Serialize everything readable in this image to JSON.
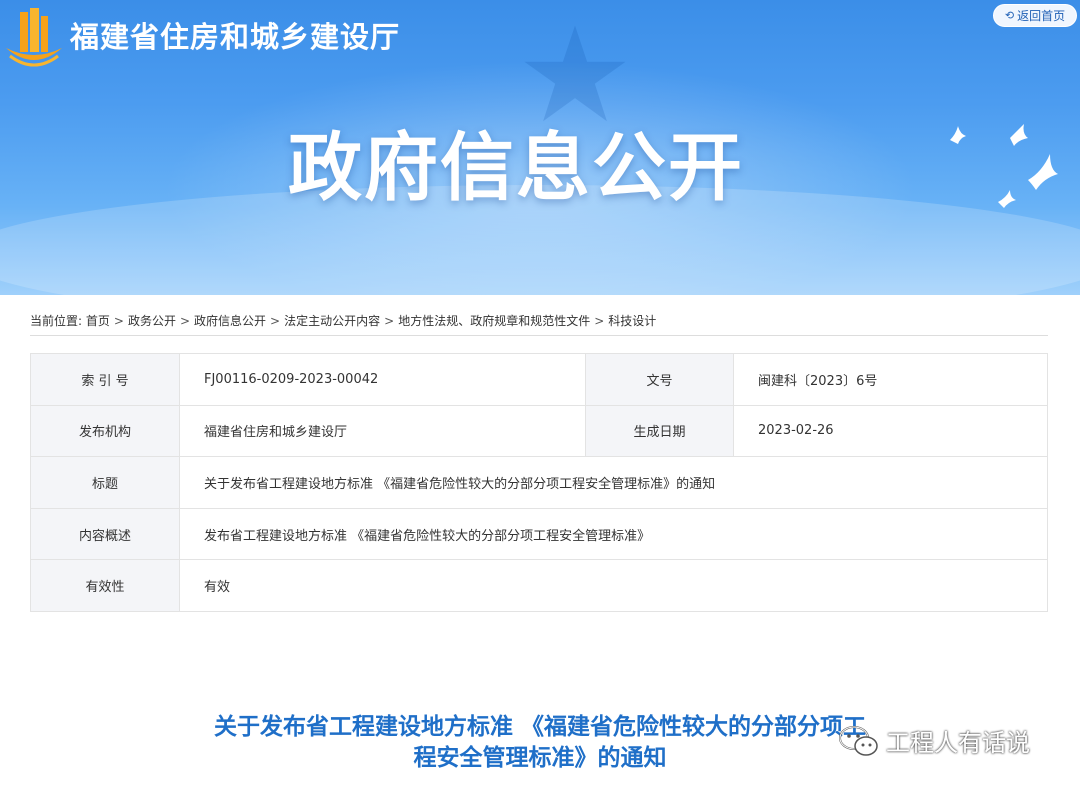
{
  "header": {
    "site_name": "福建省住房和城乡建设厅",
    "back_home": "返回首页",
    "banner_title": "政府信息公开"
  },
  "breadcrumb": {
    "prefix": "当前位置:",
    "items": [
      "首页",
      "政务公开",
      "政府信息公开",
      "法定主动公开内容",
      "地方性法规、政府规章和规范性文件",
      "科技设计"
    ],
    "separator": ">"
  },
  "meta": {
    "index_label": "索 引 号",
    "index_value": "FJ00116-0209-2023-00042",
    "docno_label": "文号",
    "docno_value": "闽建科〔2023〕6号",
    "publisher_label": "发布机构",
    "publisher_value": "福建省住房和城乡建设厅",
    "date_label": "生成日期",
    "date_value": "2023-02-26",
    "title_label": "标题",
    "title_value": "关于发布省工程建设地方标准 《福建省危险性较大的分部分项工程安全管理标准》的通知",
    "summary_label": "内容概述",
    "summary_value": "发布省工程建设地方标准 《福建省危险性较大的分部分项工程安全管理标准》",
    "validity_label": "有效性",
    "validity_value": "有效"
  },
  "article": {
    "title_line1": "关于发布省工程建设地方标准 《福建省危险性较大的分部分项工",
    "title_line2": "程安全管理标准》的通知"
  },
  "watermark": {
    "text": "工程人有话说",
    "icon": "wechat-icon"
  },
  "colors": {
    "banner_top": "#3b8ee8",
    "banner_bottom": "#9fd0fb",
    "title_blue": "#1f6fc8",
    "table_label_bg": "#f4f5f8"
  }
}
